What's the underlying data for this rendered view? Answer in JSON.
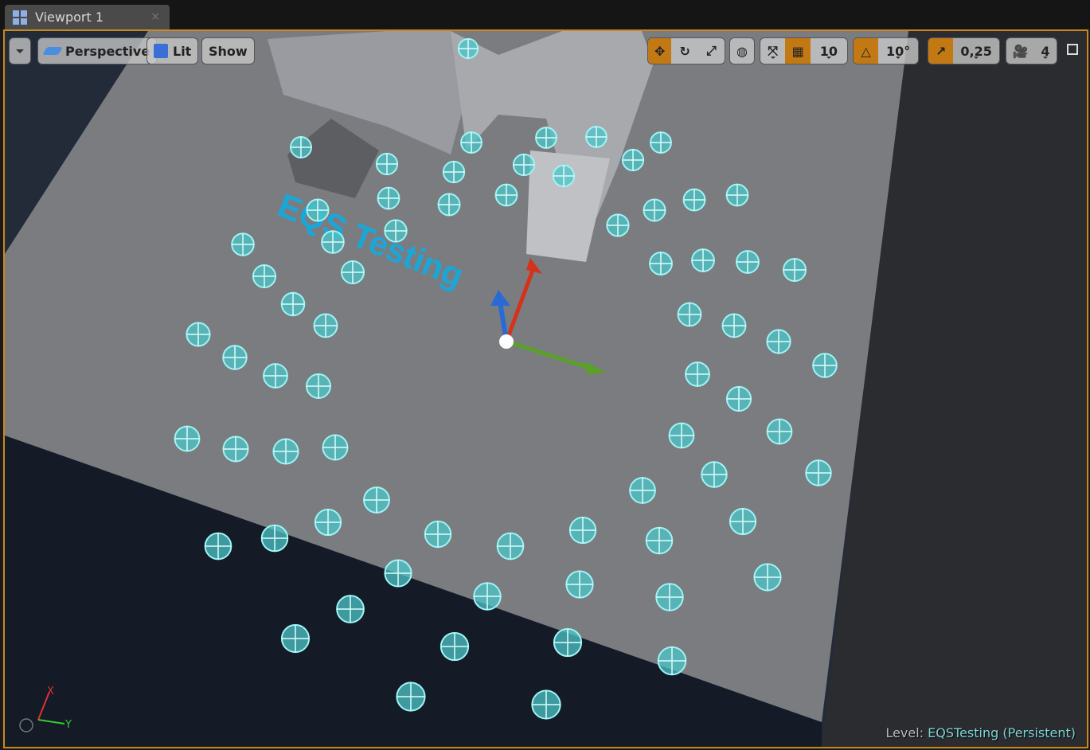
{
  "tab": {
    "title": "Viewport 1",
    "close": "×"
  },
  "toolbar": {
    "menu_icon": "chevron-down-icon",
    "perspective": "Perspective",
    "lit": "Lit",
    "show": "Show",
    "grid_snap": "10",
    "rotation_snap": "10°",
    "scale_snap": "0,25",
    "camera_speed": "4",
    "active_color": "#c27914"
  },
  "scene": {
    "label": "EQS Testing"
  },
  "axes": {
    "x": "X",
    "y": "Y"
  },
  "status": {
    "level_label": "Level:",
    "level_name": "EQSTesting (Persistent)"
  },
  "colors": {
    "border": "#c88a1c",
    "marker": "#6fe0e0",
    "level_text": "#7fd4d6"
  }
}
